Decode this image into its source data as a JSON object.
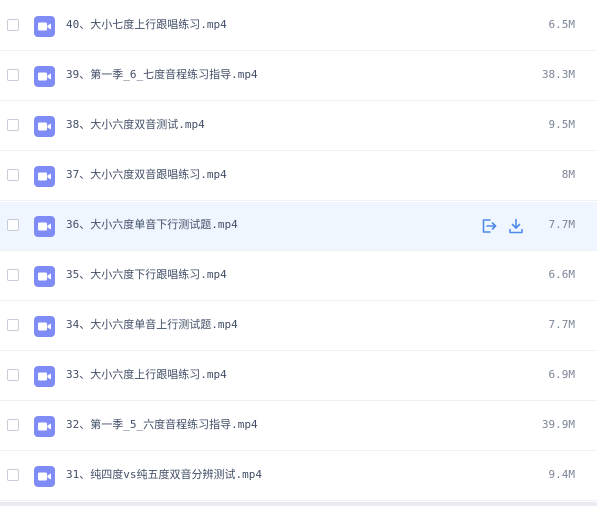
{
  "colors": {
    "video_icon": "#7f8cf6",
    "action_icon": "#4f8ae6",
    "highlight_row": "#f0f6ff"
  },
  "files": [
    {
      "name": "40、大小七度上行跟唱练习.mp4",
      "size": "6.5M",
      "icon": "video-file-icon"
    },
    {
      "name": "39、第一季_6_七度音程练习指导.mp4",
      "size": "38.3M",
      "icon": "video-file-icon"
    },
    {
      "name": "38、大小六度双音测试.mp4",
      "size": "9.5M",
      "icon": "video-file-icon"
    },
    {
      "name": "37、大小六度双音跟唱练习.mp4",
      "size": "8M",
      "icon": "video-file-icon"
    },
    {
      "name": "36、大小六度单音下行测试题.mp4",
      "size": "7.7M",
      "icon": "video-file-icon",
      "hovered": true,
      "actions": [
        "share-icon",
        "download-icon"
      ]
    },
    {
      "name": "35、大小六度下行跟唱练习.mp4",
      "size": "6.6M",
      "icon": "video-file-icon"
    },
    {
      "name": "34、大小六度单音上行测试题.mp4",
      "size": "7.7M",
      "icon": "video-file-icon"
    },
    {
      "name": "33、大小六度上行跟唱练习.mp4",
      "size": "6.9M",
      "icon": "video-file-icon"
    },
    {
      "name": "32、第一季_5_六度音程练习指导.mp4",
      "size": "39.9M",
      "icon": "video-file-icon"
    },
    {
      "name": "31、纯四度vs纯五度双音分辨测试.mp4",
      "size": "9.4M",
      "icon": "video-file-icon"
    }
  ]
}
